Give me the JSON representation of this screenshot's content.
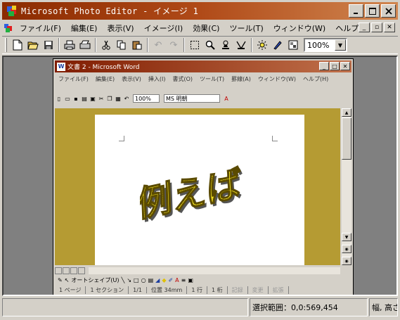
{
  "window": {
    "title": "Microsoft Photo Editor - イメージ 1"
  },
  "menu": [
    "ファイル(F)",
    "編集(E)",
    "表示(V)",
    "イメージ(I)",
    "効果(C)",
    "ツール(T)",
    "ウィンドウ(W)",
    "ヘルプ(H)"
  ],
  "toolbar": {
    "zoom_value": "100%"
  },
  "inner_window": {
    "title": "文書 2 - Microsoft Word",
    "menu": [
      "ファイル(F)",
      "編集(E)",
      "表示(V)",
      "挿入(I)",
      "書式(O)",
      "ツール(T)",
      "罫線(A)",
      "ウィンドウ(W)",
      "ヘルプ(H)"
    ],
    "zoom": "100%",
    "font": "MS 明朝",
    "wordart_text": "例えば",
    "drawbar": {
      "autoshape": "オートシェイプ(U)"
    },
    "status": {
      "page": "1 ページ",
      "section": "1 セクション",
      "pages": "1/1",
      "pos": "位置 34mm",
      "line": "1 行",
      "col": "1 桁",
      "rec": "記録",
      "trk": "変更",
      "ext": "拡張"
    }
  },
  "status": {
    "help": "",
    "selection": "選択範囲：0,0:569,454",
    "size": "幅, 高さ"
  },
  "colors": {
    "title_bar": "#8b2b00",
    "wordart_fill": "#ffee22",
    "document_bg": "#b59b33"
  }
}
